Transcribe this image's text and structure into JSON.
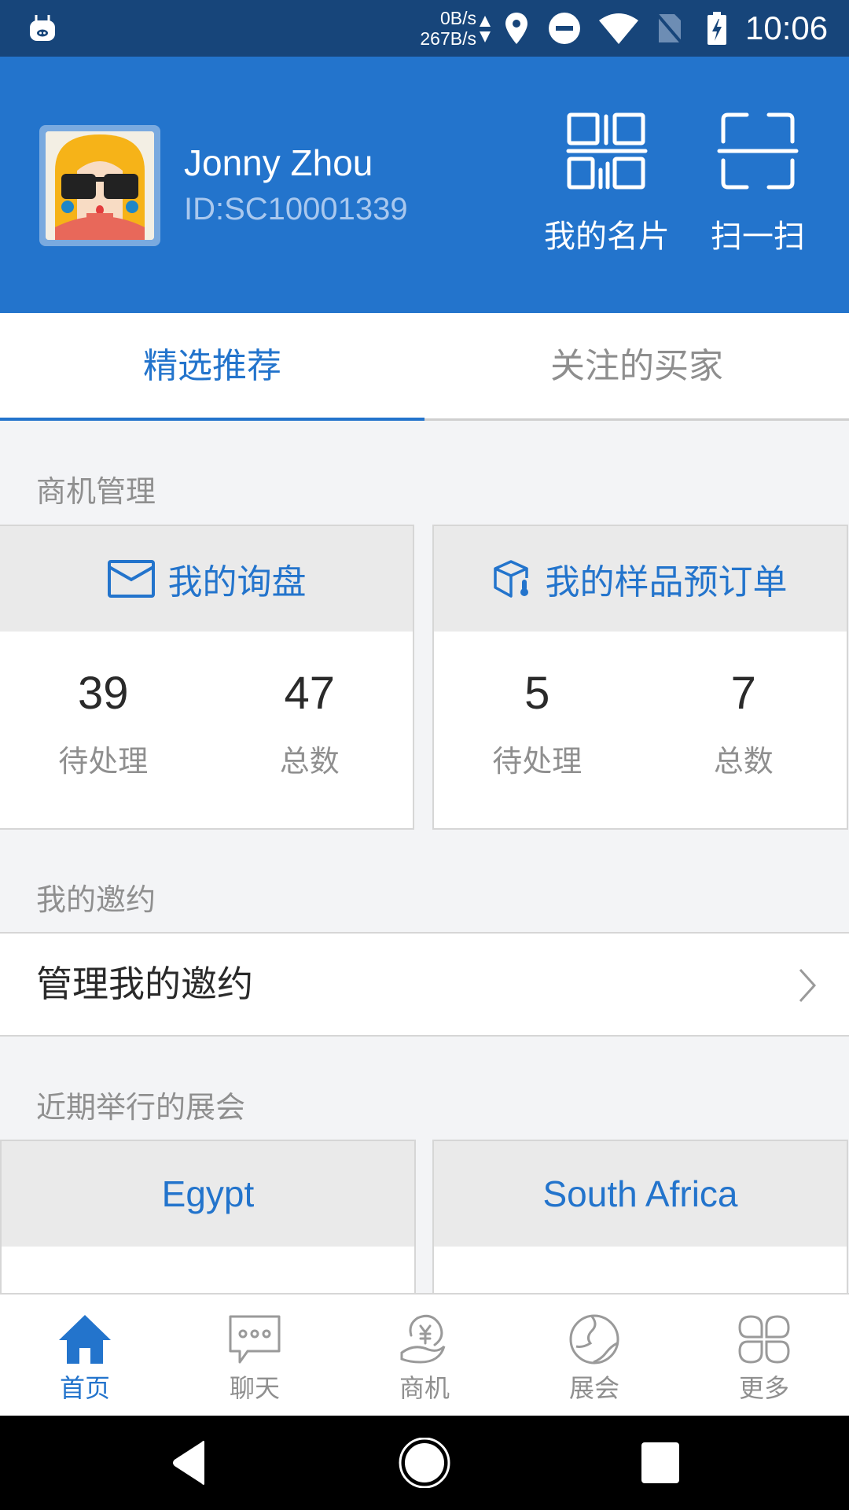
{
  "status_bar": {
    "net_up": "0B/s",
    "net_down": "267B/s",
    "time": "10:06",
    "icons": [
      "app-notification-icon",
      "data-arrows-icon",
      "location-icon",
      "do-not-disturb-icon",
      "wifi-icon",
      "no-sim-icon",
      "battery-charging-icon"
    ]
  },
  "header": {
    "user_name": "Jonny Zhou",
    "user_id": "ID:SC10001339",
    "business_card_label": "我的名片",
    "scan_label": "扫一扫"
  },
  "tabs": [
    {
      "label": "精选推荐",
      "active": true
    },
    {
      "label": "关注的买家",
      "active": false
    }
  ],
  "opportunities": {
    "section_label": "商机管理",
    "cards": [
      {
        "title": "我的询盘",
        "icon": "envelope-icon",
        "stats": [
          {
            "value": "39",
            "caption": "待处理"
          },
          {
            "value": "47",
            "caption": "总数"
          }
        ]
      },
      {
        "title": "我的样品预订单",
        "icon": "sample-box-icon",
        "stats": [
          {
            "value": "5",
            "caption": "待处理"
          },
          {
            "value": "7",
            "caption": "总数"
          }
        ]
      }
    ]
  },
  "invitations": {
    "section_label": "我的邀约",
    "row_label": "管理我的邀约"
  },
  "expos": {
    "section_label": "近期举行的展会",
    "items": [
      {
        "name": "Egypt"
      },
      {
        "name": "South Africa"
      }
    ]
  },
  "bottom_nav": [
    {
      "label": "首页",
      "icon": "home-icon",
      "active": true
    },
    {
      "label": "聊天",
      "icon": "chat-icon",
      "active": false
    },
    {
      "label": "商机",
      "icon": "business-opportunity-icon",
      "active": false
    },
    {
      "label": "展会",
      "icon": "globe-icon",
      "active": false
    },
    {
      "label": "更多",
      "icon": "more-grid-icon",
      "active": false
    }
  ],
  "colors": {
    "status_bar": "#17457a",
    "brand_blue": "#2374cc",
    "background": "#f3f4f6",
    "card_header": "#eaeaea",
    "muted_text": "#8f8f8f",
    "dark_text": "#2a2a2a"
  }
}
